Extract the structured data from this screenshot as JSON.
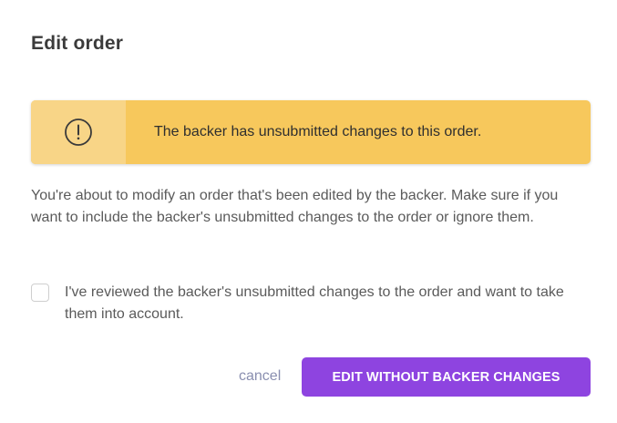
{
  "dialog": {
    "title": "Edit order"
  },
  "alert": {
    "icon": "exclamation-circle-icon",
    "message": "The backer has unsubmitted changes to this order.",
    "colors": {
      "background": "#f7c85c",
      "icon_panel": "#f8d587"
    }
  },
  "description": "You're about to modify an order that's been edited by the backer. Make sure if you want to include the backer's unsubmitted changes to the order or ignore them.",
  "confirm_checkbox": {
    "checked": false,
    "label": "I've reviewed the backer's unsubmitted changes to the order and want to take them into account."
  },
  "actions": {
    "cancel_label": "cancel",
    "primary_label": "EDIT WITHOUT BACKER CHANGES",
    "primary_color": "#8e44e0"
  }
}
